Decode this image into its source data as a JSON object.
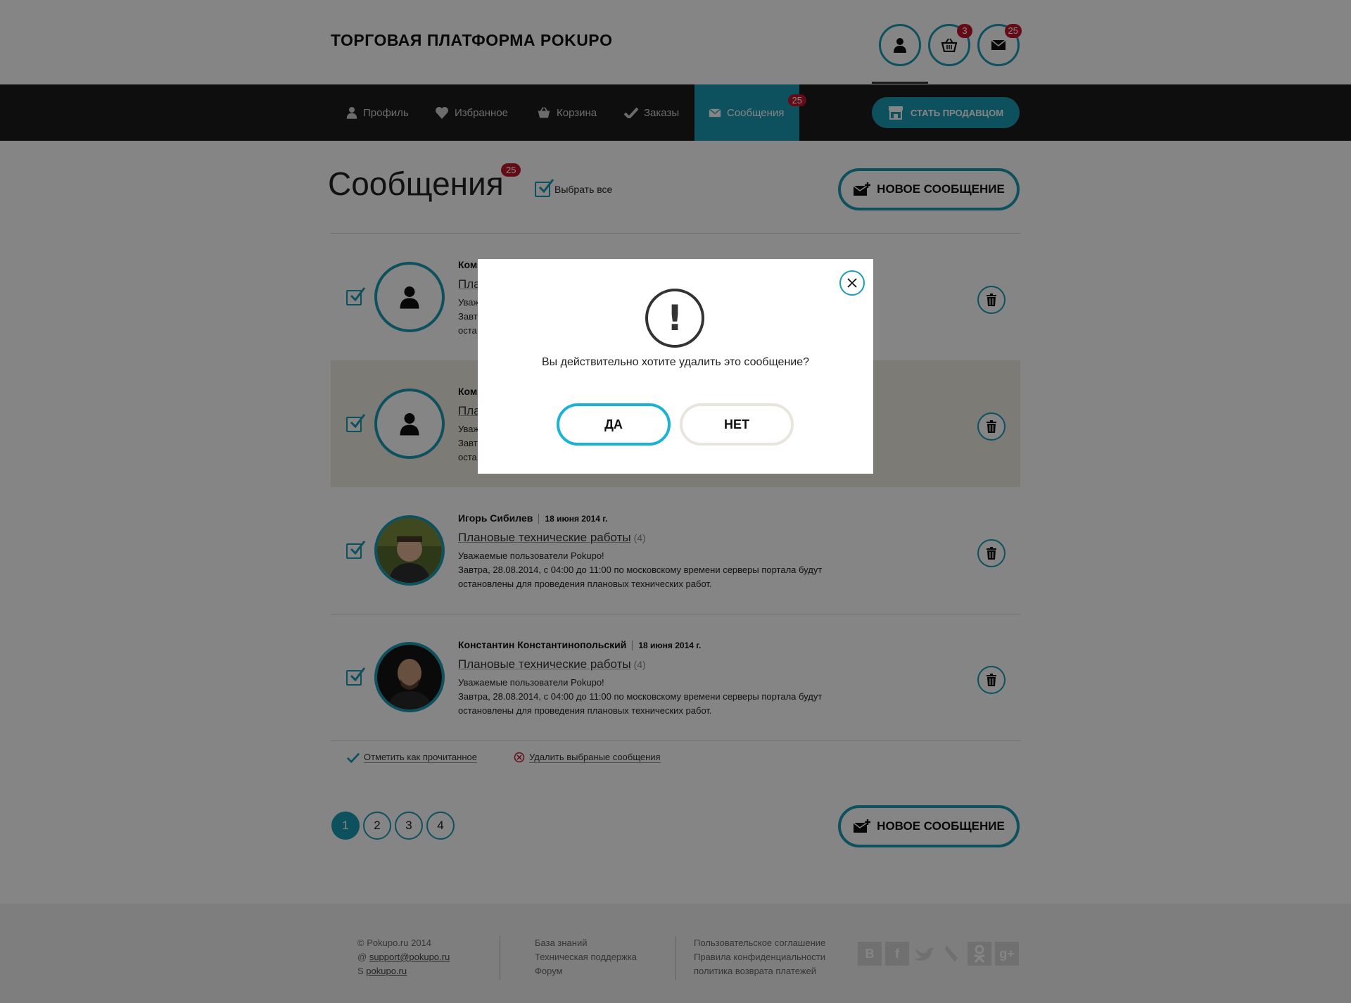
{
  "header": {
    "brand": "ТОРГОВАЯ ПЛАТФОРМА POKUPO",
    "cart_badge": "3",
    "mail_badge": "25"
  },
  "nav": {
    "items": [
      {
        "label": "Профиль",
        "icon": "user-icon"
      },
      {
        "label": "Избранное",
        "icon": "heart-icon"
      },
      {
        "label": "Корзина",
        "icon": "basket-icon"
      },
      {
        "label": "Заказы",
        "icon": "check-icon"
      },
      {
        "label": "Сообщения",
        "icon": "mail-icon",
        "badge": "25",
        "active": true
      }
    ],
    "become_seller": "СТАТЬ ПРОДАВЦОМ"
  },
  "page": {
    "title": "Сообщения",
    "badge": "25",
    "select_all": "Выбрать все",
    "new_message": "НОВОЕ СООБЩЕНИЕ"
  },
  "messages": [
    {
      "author": "Ком",
      "date": "",
      "subject": "Пла",
      "count": "",
      "line1": "Уваж",
      "line2": "Завт",
      "line3": "оста",
      "avatar": "placeholder-user",
      "highlighted": false
    },
    {
      "author": "Ком",
      "date": "",
      "subject": "Пла",
      "count": "",
      "line1": "Уваж",
      "line2": "Завт",
      "line3": "оста",
      "avatar": "placeholder-user",
      "highlighted": true
    },
    {
      "author": "Игорь Сибилев",
      "date": "18 июня 2014 г.",
      "subject": "Плановые технические работы",
      "count": "(4)",
      "line1": "Уважаемые пользователи Pokupo!",
      "line2": "Завтра, 28.08.2014, с 04:00 до 11:00 по московскому времени серверы портала будут",
      "line3": "остановлены для проведения плановых технических работ.",
      "avatar": "photo",
      "highlighted": false
    },
    {
      "author": "Константин Константинопольский",
      "date": "18 июня 2014 г.",
      "subject": "Плановые технические работы",
      "count": "(4)",
      "line1": "Уважаемые пользователи Pokupo!",
      "line2": "Завтра, 28.08.2014, с 04:00 до 11:00 по московскому времени серверы портала будут",
      "line3": "остановлены для проведения плановых технических работ.",
      "avatar": "photo",
      "highlighted": false
    }
  ],
  "bulk": {
    "mark_read": "Отметить как прочитанное",
    "delete_selected": "Удалить выбраные сообщения"
  },
  "pagination": {
    "pages": [
      "1",
      "2",
      "3",
      "4"
    ],
    "current": "1"
  },
  "footer": {
    "copyright": "Pokupo.ru 2014",
    "email": "support@pokupo.ru",
    "skype": "pokupo.ru",
    "links1": [
      "База знаний",
      "Техническая поддержка",
      "Форум"
    ],
    "links2": [
      "Пользовательское соглашение",
      "Правила конфиденциальности",
      "политика возврата платежей"
    ],
    "social": [
      "В",
      "f",
      "twitter-icon",
      "feather-icon",
      "ok-icon",
      "g+"
    ]
  },
  "modal": {
    "text": "Вы действительно хотите удалить это сообщение?",
    "yes": "ДА",
    "no": "НЕТ"
  },
  "colors": {
    "accent": "#1b9cb5",
    "badge": "#c0162c",
    "nav_bg": "#1b1b1b",
    "highlight_row": "#efece3"
  }
}
